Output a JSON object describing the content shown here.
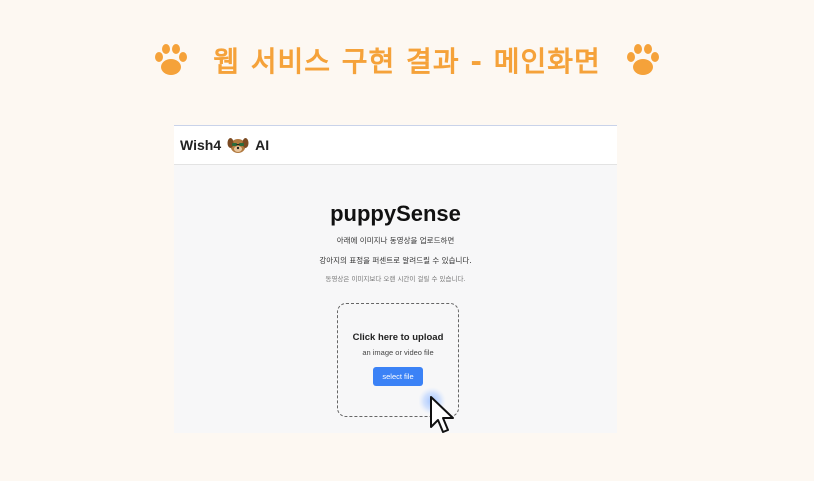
{
  "slide": {
    "title": "웹 서비스 구현 결과 - 메인화면"
  },
  "navbar": {
    "brand_left": "Wish4",
    "brand_right": "AI"
  },
  "main": {
    "title": "puppySense",
    "desc_line1": "아래에 이미지나 동영상을 업로드하면",
    "desc_line2": "강아지의 표정을 퍼센트로 알려드릴 수 있습니다.",
    "desc_note": "동영상은 이미지보다 오랜 시간이 걸릴 수 있습니다."
  },
  "upload": {
    "title": "Click here to upload",
    "subtitle": "an image or video file",
    "button_label": "select file"
  },
  "colors": {
    "accent_orange": "#f5a23a",
    "button_blue": "#3b82f6",
    "background": "#fdf8f2"
  },
  "icons": [
    "paw-icon",
    "dog-logo-icon",
    "mouse-cursor-icon"
  ]
}
